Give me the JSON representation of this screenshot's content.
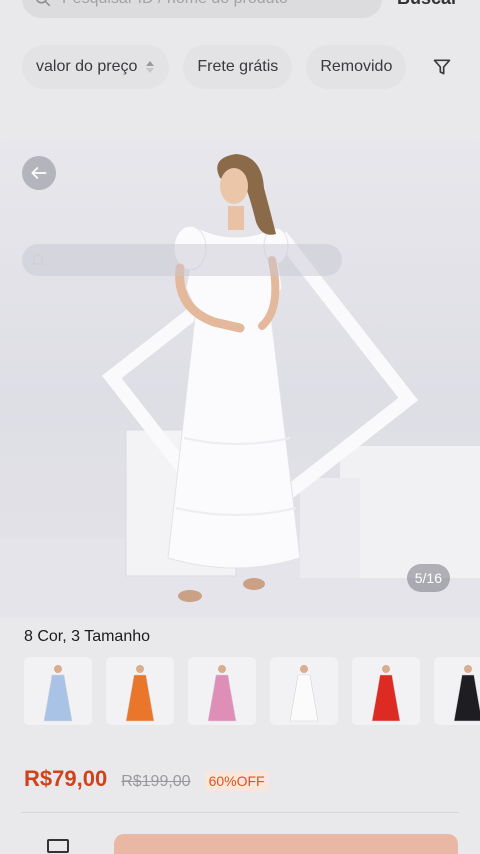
{
  "search": {
    "placeholder": "Pesquisar ID / nome do produto",
    "button_label": "Buscar"
  },
  "filters": {
    "price_label": "valor do preço",
    "shipping_label": "Frete grátis",
    "removed_label": "Removido"
  },
  "hero": {
    "counter": "5/16"
  },
  "variants": {
    "title": "8 Cor, 3 Tamanho",
    "thumbs": [
      {
        "color": "#a9c3e6"
      },
      {
        "color": "#e9762a"
      },
      {
        "color": "#df8fb7"
      },
      {
        "color": "#fbfbfb"
      },
      {
        "color": "#dd2a22"
      },
      {
        "color": "#1d1d22"
      }
    ]
  },
  "pricing": {
    "price": "R$79,00",
    "old_price": "R$199,00",
    "discount": "60%OFF"
  },
  "colors": {
    "accent": "#d1421b",
    "buy_button": "#e9b8a5"
  }
}
